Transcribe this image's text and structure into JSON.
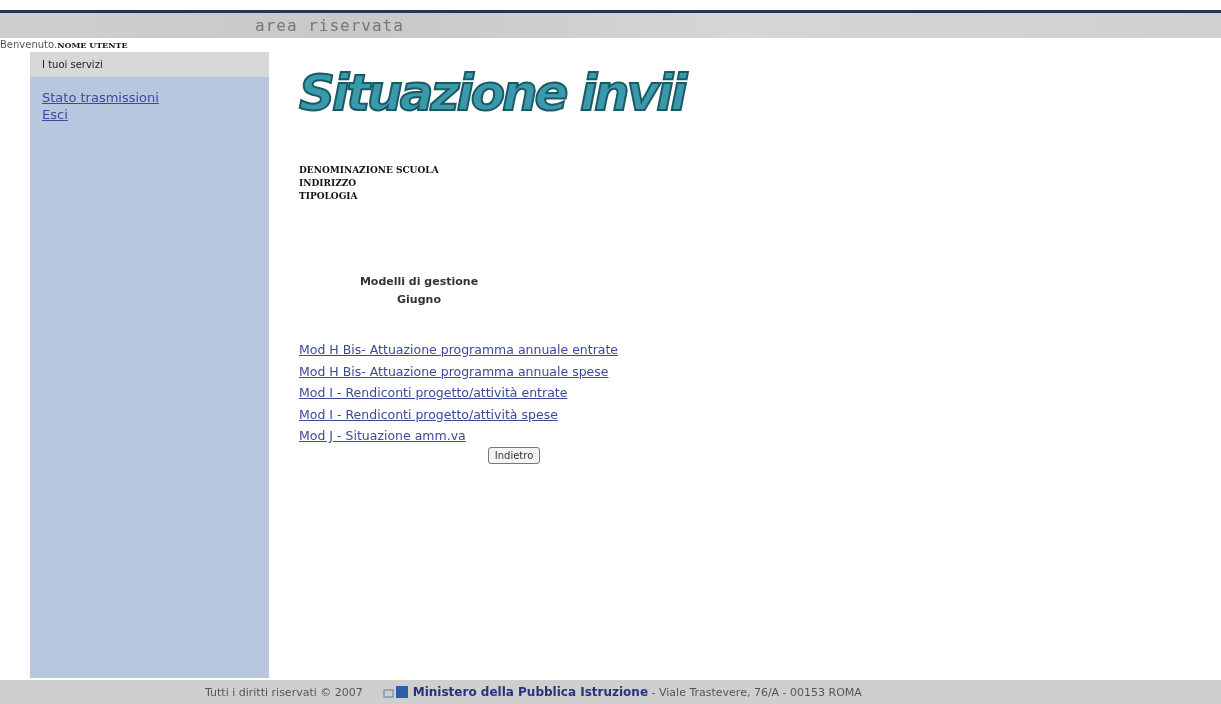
{
  "header": {
    "title": "area riservata"
  },
  "welcome": {
    "label": "Benvenuto.",
    "user": "NOME UTENTE"
  },
  "sidebar": {
    "heading": "I tuoi servizi",
    "items": [
      {
        "label": "Stato trasmissioni"
      },
      {
        "label": "Esci"
      }
    ]
  },
  "page_title": "Situazione invii",
  "school": [
    "DENOMINAZIONE SCUOLA",
    "INDIRIZZO",
    "TIPOLOGIA"
  ],
  "section": {
    "title": "Modelli di gestione",
    "month": "Giugno"
  },
  "links": [
    "Mod H Bis- Attuazione programma annuale entrate",
    "Mod H Bis- Attuazione programma annuale spese",
    "Mod I - Rendiconti progetto/attività entrate",
    "Mod I - Rendiconti progetto/attività spese",
    "Mod J - Situazione amm.va"
  ],
  "back_button": "Indietro",
  "footer": {
    "copyright": "Tutti i diritti riservati © 2007",
    "ministry": "**Ministero della Pubblica Istruzione** - Viale Trastevere, 76/A - 00153 ROMA"
  }
}
